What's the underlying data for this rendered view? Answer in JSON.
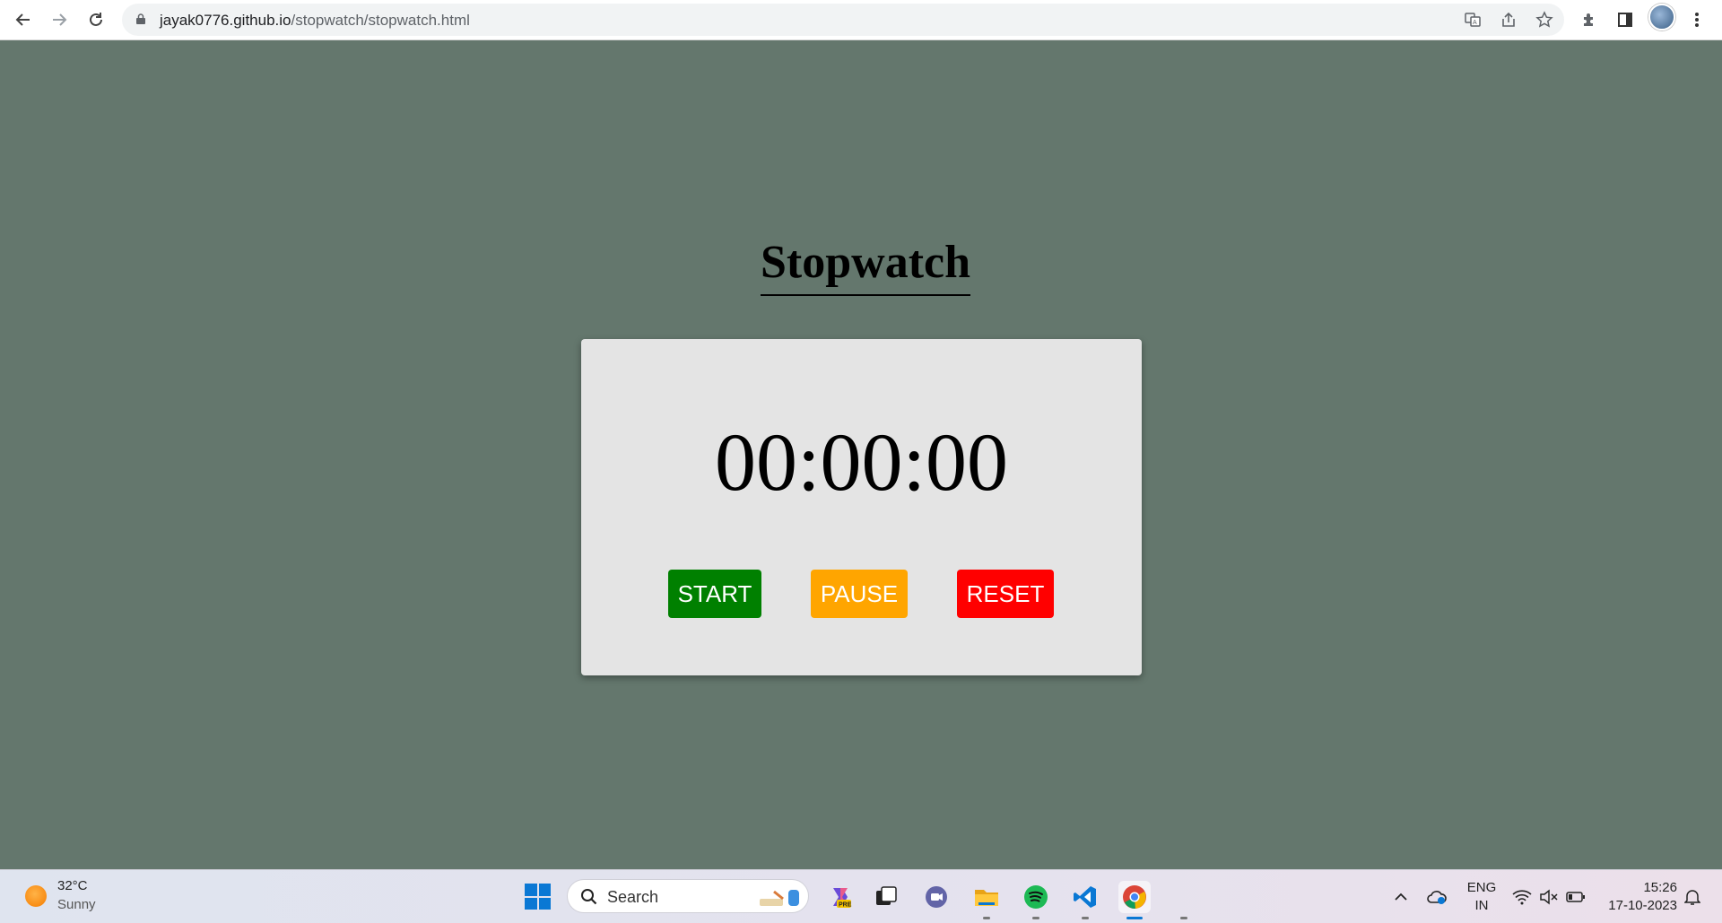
{
  "browser": {
    "url_host": "jayak0776.github.io",
    "url_path": "/stopwatch/stopwatch.html"
  },
  "page": {
    "title": "Stopwatch",
    "time": "00:00:00",
    "buttons": {
      "start": "START",
      "pause": "PAUSE",
      "reset": "RESET"
    },
    "colors": {
      "background": "#64776d",
      "card": "#e4e4e4",
      "start": "#008000",
      "pause": "#ffa500",
      "reset": "#ff0000"
    }
  },
  "taskbar": {
    "weather_temp": "32°C",
    "weather_desc": "Sunny",
    "search_label": "Search",
    "apps": [
      "windows-icon",
      "copilot-icon",
      "task-view-icon",
      "teams-chat-icon",
      "file-explorer-icon",
      "spotify-icon",
      "vscode-icon",
      "chrome-icon"
    ],
    "lang_line1": "ENG",
    "lang_line2": "IN",
    "time": "15:26",
    "date": "17-10-2023"
  }
}
